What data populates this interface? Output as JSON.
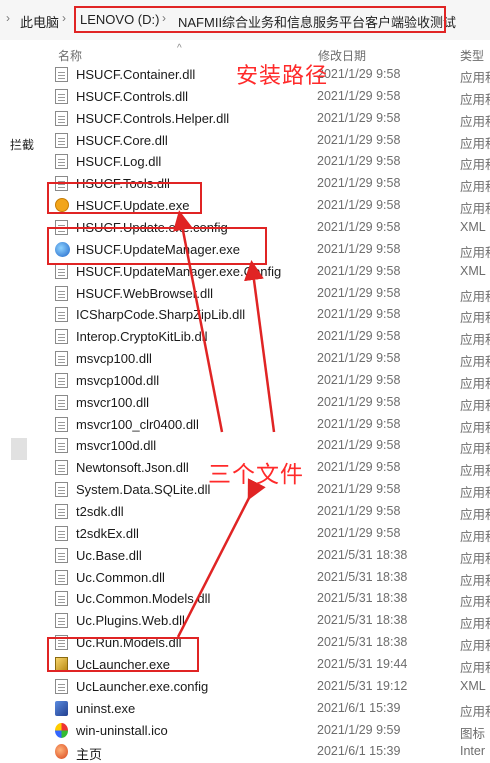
{
  "breadcrumb": {
    "pc": "此电脑",
    "drive": "LENOVO (D:)",
    "folder": "NAFMII综合业务和信息服务平台客户端验收测试"
  },
  "columns": {
    "name": "名称",
    "date": "修改日期",
    "type": "类型"
  },
  "sidebar": {
    "label": "拦截"
  },
  "annotations": {
    "install_path": "安装路径",
    "three_files": "三个文件",
    "color": "#ff2a2a"
  },
  "files": [
    {
      "name": "HSUCF.Container.dll",
      "date": "2021/1/29 9:58",
      "type": "应用程",
      "icon": "dll-icon"
    },
    {
      "name": "HSUCF.Controls.dll",
      "date": "2021/1/29 9:58",
      "type": "应用程",
      "icon": "dll-icon"
    },
    {
      "name": "HSUCF.Controls.Helper.dll",
      "date": "2021/1/29 9:58",
      "type": "应用程",
      "icon": "dll-icon"
    },
    {
      "name": "HSUCF.Core.dll",
      "date": "2021/1/29 9:58",
      "type": "应用程",
      "icon": "dll-icon"
    },
    {
      "name": "HSUCF.Log.dll",
      "date": "2021/1/29 9:58",
      "type": "应用程",
      "icon": "dll-icon"
    },
    {
      "name": "HSUCF.Tools.dll",
      "date": "2021/1/29 9:58",
      "type": "应用程",
      "icon": "dll-icon"
    },
    {
      "name": "HSUCF.Update.exe",
      "date": "2021/1/29 9:58",
      "type": "应用程",
      "icon": "update-exe-icon"
    },
    {
      "name": "HSUCF.Update.exe.config",
      "date": "2021/1/29 9:58",
      "type": "XML",
      "icon": "config-icon"
    },
    {
      "name": "HSUCF.UpdateManager.exe",
      "date": "2021/1/29 9:58",
      "type": "应用程",
      "icon": "update-manager-icon"
    },
    {
      "name": "HSUCF.UpdateManager.exe.Config",
      "date": "2021/1/29 9:58",
      "type": "XML",
      "icon": "config-icon"
    },
    {
      "name": "HSUCF.WebBrowser.dll",
      "date": "2021/1/29 9:58",
      "type": "应用程",
      "icon": "dll-icon"
    },
    {
      "name": "ICSharpCode.SharpZipLib.dll",
      "date": "2021/1/29 9:58",
      "type": "应用程",
      "icon": "dll-icon"
    },
    {
      "name": "Interop.CryptoKitLib.dll",
      "date": "2021/1/29 9:58",
      "type": "应用程",
      "icon": "dll-icon"
    },
    {
      "name": "msvcp100.dll",
      "date": "2021/1/29 9:58",
      "type": "应用程",
      "icon": "dll-icon"
    },
    {
      "name": "msvcp100d.dll",
      "date": "2021/1/29 9:58",
      "type": "应用程",
      "icon": "dll-icon"
    },
    {
      "name": "msvcr100.dll",
      "date": "2021/1/29 9:58",
      "type": "应用程",
      "icon": "dll-icon"
    },
    {
      "name": "msvcr100_clr0400.dll",
      "date": "2021/1/29 9:58",
      "type": "应用程",
      "icon": "dll-icon"
    },
    {
      "name": "msvcr100d.dll",
      "date": "2021/1/29 9:58",
      "type": "应用程",
      "icon": "dll-icon"
    },
    {
      "name": "Newtonsoft.Json.dll",
      "date": "2021/1/29 9:58",
      "type": "应用程",
      "icon": "dll-icon"
    },
    {
      "name": "System.Data.SQLite.dll",
      "date": "2021/1/29 9:58",
      "type": "应用程",
      "icon": "dll-icon"
    },
    {
      "name": "t2sdk.dll",
      "date": "2021/1/29 9:58",
      "type": "应用程",
      "icon": "dll-icon"
    },
    {
      "name": "t2sdkEx.dll",
      "date": "2021/1/29 9:58",
      "type": "应用程",
      "icon": "dll-icon"
    },
    {
      "name": "Uc.Base.dll",
      "date": "2021/5/31 18:38",
      "type": "应用程",
      "icon": "dll-icon"
    },
    {
      "name": "Uc.Common.dll",
      "date": "2021/5/31 18:38",
      "type": "应用程",
      "icon": "dll-icon"
    },
    {
      "name": "Uc.Common.Models.dll",
      "date": "2021/5/31 18:38",
      "type": "应用程",
      "icon": "dll-icon"
    },
    {
      "name": "Uc.Plugins.Web.dll",
      "date": "2021/5/31 18:38",
      "type": "应用程",
      "icon": "dll-icon"
    },
    {
      "name": "Uc.Run.Models.dll",
      "date": "2021/5/31 18:38",
      "type": "应用程",
      "icon": "dll-icon"
    },
    {
      "name": "UcLauncher.exe",
      "date": "2021/5/31 19:44",
      "type": "应用程",
      "icon": "launcher-icon"
    },
    {
      "name": "UcLauncher.exe.config",
      "date": "2021/5/31 19:12",
      "type": "XML",
      "icon": "config-icon"
    },
    {
      "name": "uninst.exe",
      "date": "2021/6/1 15:39",
      "type": "应用程",
      "icon": "uninstall-icon"
    },
    {
      "name": "win-uninstall.ico",
      "date": "2021/1/29 9:59",
      "type": "图标",
      "icon": "ico-file-icon"
    },
    {
      "name": "主页",
      "date": "2021/6/1 15:39",
      "type": "Inter",
      "icon": "web-shortcut-icon"
    }
  ]
}
